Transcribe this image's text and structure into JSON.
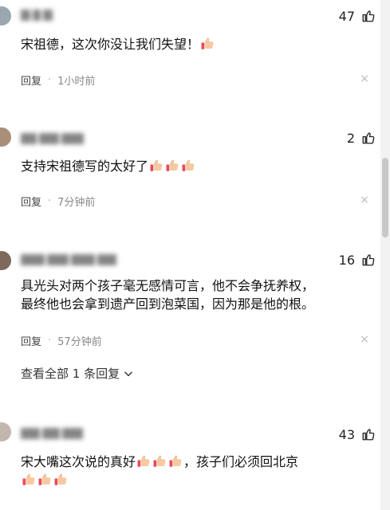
{
  "comments": [
    {
      "likes": "47",
      "text": "宋祖德，这次你没让我们失望！",
      "reply_label": "回复",
      "time": "1小时前"
    },
    {
      "likes": "2",
      "text": "支持宋祖德写的太好了",
      "reply_label": "回复",
      "time": "7分钟前"
    },
    {
      "likes": "16",
      "text_line1": "具光头对两个孩子毫无感情可言，他不会争抚养权，",
      "text_line2": "最终他也会拿到遗产回到泡菜国，因为那是他的根。",
      "reply_label": "回复",
      "time": "57分钟前",
      "view_replies": "查看全部 1 条回复"
    },
    {
      "likes": "43",
      "text_part1": "宋大嘴这次说的真好",
      "text_part2": "，孩子们必须回北京"
    }
  ],
  "icons": {
    "like": "thumbs-up-outline",
    "emoji": "thumbs-up-emoji",
    "close": "close-x",
    "expand": "chevron-down"
  },
  "colors": {
    "emoji_fill": "#f7c9a1",
    "emoji_accent": "#e8495a",
    "meta_text": "#888888"
  }
}
